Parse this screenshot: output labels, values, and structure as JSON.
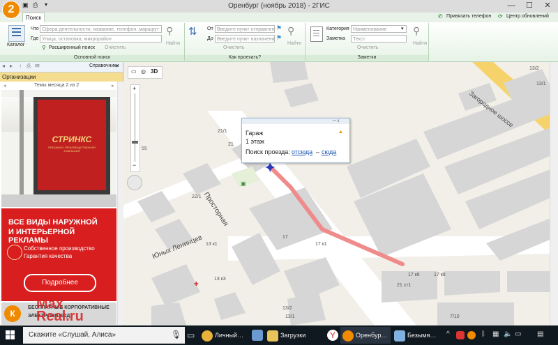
{
  "window": {
    "title": "Оренбург (ноябрь 2018) - 2ГИС",
    "logo": "2",
    "controls": {
      "minimize": "—",
      "maximize": "☐",
      "close": "✕"
    }
  },
  "ribbon": {
    "tab_search": "Поиск",
    "top_links": {
      "link_phone": "Привязать телефон",
      "updates": "Центр обновлений"
    },
    "search": {
      "catalog_label": "Каталог",
      "what_label": "Что",
      "what_placeholder": "Сфера деятельности, название, телефон, маршрут",
      "where_label": "Где",
      "where_placeholder": "Улица, остановка, микрорайон",
      "find_label": "Найти",
      "advanced_label": "Расширенный поиск",
      "clear_label": "Очистить",
      "caption": "Основной поиск"
    },
    "route": {
      "from_label": "От",
      "from_placeholder": "Введите пункт отправления",
      "to_label": "До",
      "to_placeholder": "Введите пункт назначения",
      "find_label": "Найти",
      "clear_label": "Очистить",
      "caption": "Как проехать?"
    },
    "notes": {
      "category_label": "Категория",
      "category_value": "Наименование",
      "note_label": "Заметка",
      "note_placeholder": "Текст",
      "find_label": "Найти",
      "clear_label": "Очистить",
      "caption": "Заметки"
    }
  },
  "left_panel": {
    "dropdown": "Справочники",
    "header": "Организации",
    "themes": "Темы месяца 2 из 2",
    "ad_poster_brand": "СТРИНКС",
    "ad_poster_sub": "РЕКЛАМНО-ПРОИЗВОДСТВЕННАЯ КОМПАНИЯ",
    "ad_headline_1": "ВСЕ ВИДЫ НАРУЖНОЙ",
    "ad_headline_2": "И ИНТЕРЬЕРНОЙ РЕКЛАМЫ",
    "ad_text_1": "Собственное производство",
    "ad_text_2": "Гарантия качества",
    "ad_button": "Подробнее",
    "ad3_logo": "К",
    "ad3_text_1": "БЕСПЛАТНЫЕ КОРПОРАТИВНЫЕ",
    "ad3_text_2": "ЭЛЕКТРОНН ВОД",
    "watermark_1": "Max",
    "watermark_2": "Real.ru"
  },
  "map": {
    "view_3d": "3D",
    "zoom_tick": "55",
    "streets": {
      "prostornaya": "Просторная",
      "yunykh": "Юных Ленинцев",
      "zagorodnoe": "Загородное шоссе"
    },
    "buildings": [
      "21/1",
      "22/1",
      "21",
      "13/2",
      "13/1",
      "13 к1",
      "13 к3",
      "17",
      "17 к1",
      "17 к6",
      "21 ст1",
      "17 к8",
      "7/10",
      "13/2",
      "13/1"
    ],
    "popup": {
      "title": "Гараж",
      "floors": "1 этаж",
      "route_prefix": "Поиск проезда:",
      "link_from": "отсюда",
      "dash": "–",
      "link_to": "сюда",
      "warn": "▲",
      "win_btns": "ꟷ x"
    }
  },
  "taskbar": {
    "search_placeholder": "Скажите «Слушай, Алиса»",
    "apps": [
      {
        "label": "Личный…",
        "color": "#e9b23a"
      },
      {
        "label": "Загрузки",
        "color": "#e8c45a"
      },
      {
        "label": "Оренбур…",
        "color": "#f08a00"
      },
      {
        "label": "Безымя…",
        "color": "#7fb2e0"
      }
    ],
    "colors": {
      "bg": "#101820",
      "search_bg": "#f2f2f2"
    }
  },
  "colors": {
    "accent": "#f08a00",
    "route": "#f08a8a",
    "ribbon": "#e6f3e6"
  }
}
